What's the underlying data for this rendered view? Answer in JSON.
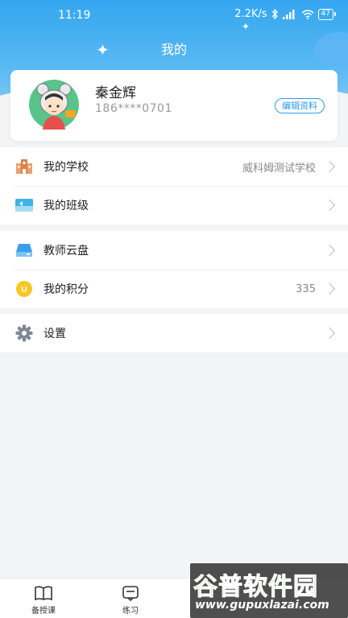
{
  "status": {
    "time": "11:19",
    "net_speed": "2.2K/s",
    "battery": "47"
  },
  "page": {
    "title": "我的"
  },
  "profile": {
    "name": "秦金辉",
    "phone": "186****0701",
    "edit_label": "编辑资料"
  },
  "menu_group_1": [
    {
      "label": "我的学校",
      "value": "威科姆测试学校",
      "icon": "school-icon"
    },
    {
      "label": "我的班级",
      "value": "",
      "icon": "class-icon"
    }
  ],
  "menu_group_2": [
    {
      "label": "教师云盘",
      "value": "",
      "icon": "cloud-disk-icon"
    },
    {
      "label": "我的积分",
      "value": "335",
      "icon": "points-icon"
    }
  ],
  "menu_group_3": [
    {
      "label": "设置",
      "value": "",
      "icon": "gear-icon"
    }
  ],
  "tabbar": [
    {
      "label": "备授课",
      "icon": "book-icon"
    },
    {
      "label": "练习",
      "icon": "practice-icon"
    }
  ],
  "watermark": {
    "title": "谷普软件园",
    "url": "www.gupuxlazai.com"
  },
  "colors": {
    "accent": "#2b9af3",
    "header": "#34a6ef",
    "background": "#f3f4f6"
  }
}
